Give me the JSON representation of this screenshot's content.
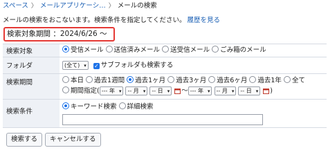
{
  "breadcrumb": {
    "items": [
      "スペース",
      "メールアプリケーシ…",
      "メールの検索"
    ],
    "separator": "〉"
  },
  "hint": {
    "text": "メールの検索をおこないます。検索条件を指定してください。",
    "history_link": "履歴を見る"
  },
  "period_summary": "検索対象期間 ：2024/6/26 〜",
  "form": {
    "target": {
      "label": "検索対象",
      "options": [
        "受信メール",
        "送信済みメール",
        "送受信メール",
        "ごみ箱のメール"
      ],
      "selected": "受信メール"
    },
    "folder": {
      "label": "フォルダ",
      "select_value": "(全て)",
      "subfolder_checkbox": "サブフォルダも検索する",
      "subfolder_checked": true
    },
    "period": {
      "label": "検索期間",
      "options": [
        "本日",
        "過去1週間",
        "過去1ヶ月",
        "過去3ヶ月",
        "過去6ヶ月",
        "過去1年",
        "全て",
        "期間指定"
      ],
      "selected": "過去1ヶ月",
      "range_prefix": "(",
      "range_suffix": ")",
      "year_placeholder": "--- 年",
      "month_placeholder": "-- 月",
      "day_placeholder": "-- 日",
      "tilde": "〜"
    },
    "condition": {
      "label": "検索条件",
      "options": [
        "キーワード検索",
        "詳細検索"
      ],
      "selected": "キーワード検索"
    }
  },
  "buttons": {
    "search": "検索する",
    "cancel": "キャンセルする"
  },
  "colors": {
    "link": "#1a5fb4",
    "highlight_border": "#e53935",
    "radio_on": "#1e73e8",
    "label_bg": "#eef1f6"
  }
}
